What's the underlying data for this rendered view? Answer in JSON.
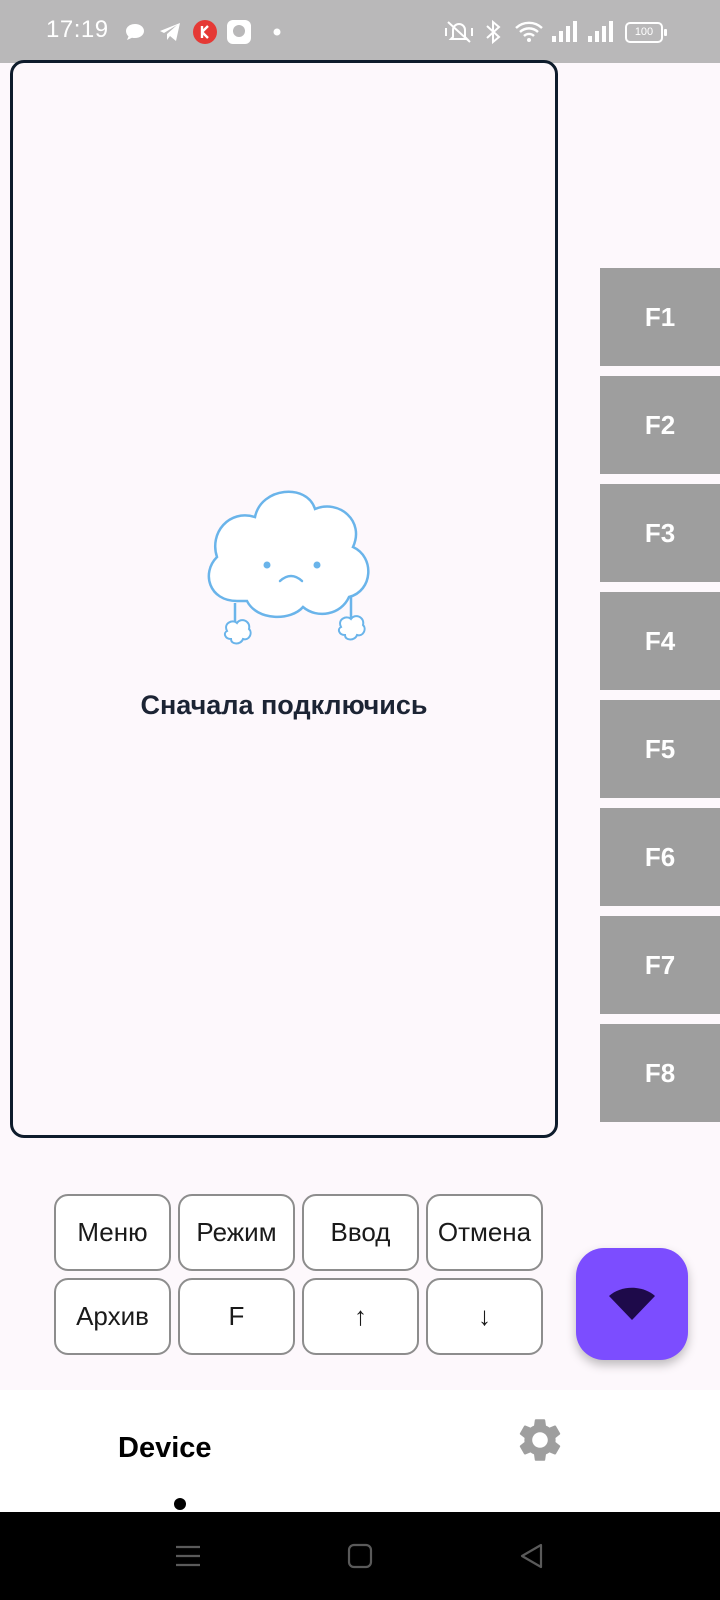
{
  "status_bar": {
    "time": "17:19",
    "battery": "100",
    "icons": [
      "chat-bubble-icon",
      "telegram-icon",
      "kaspersky-icon",
      "assistant-icon",
      "dot-icon",
      "mute-icon",
      "bluetooth-icon",
      "wifi-icon",
      "signal-icon",
      "signal-icon",
      "battery-icon"
    ]
  },
  "screen_panel": {
    "empty_message": "Сначала подключись",
    "illustration": "sad-cloud-icon"
  },
  "fkeys": [
    "F1",
    "F2",
    "F3",
    "F4",
    "F5",
    "F6",
    "F7",
    "F8"
  ],
  "keypad": {
    "row1": [
      "Меню",
      "Режим",
      "Ввод",
      "Отмена"
    ],
    "row2": [
      "Архив",
      "F",
      "↑",
      "↓"
    ]
  },
  "fab": {
    "icon": "wifi-icon",
    "color": "#7c4dff"
  },
  "bottom_nav": {
    "device_label": "Device",
    "settings_icon": "gear-icon"
  },
  "system_nav": [
    "menu-icon",
    "home-icon",
    "back-icon"
  ],
  "colors": {
    "accent": "#7c4dff",
    "fkey_bg": "#9e9e9e",
    "panel_border": "#0e1c2c",
    "cloud_stroke": "#6ab4ea"
  }
}
